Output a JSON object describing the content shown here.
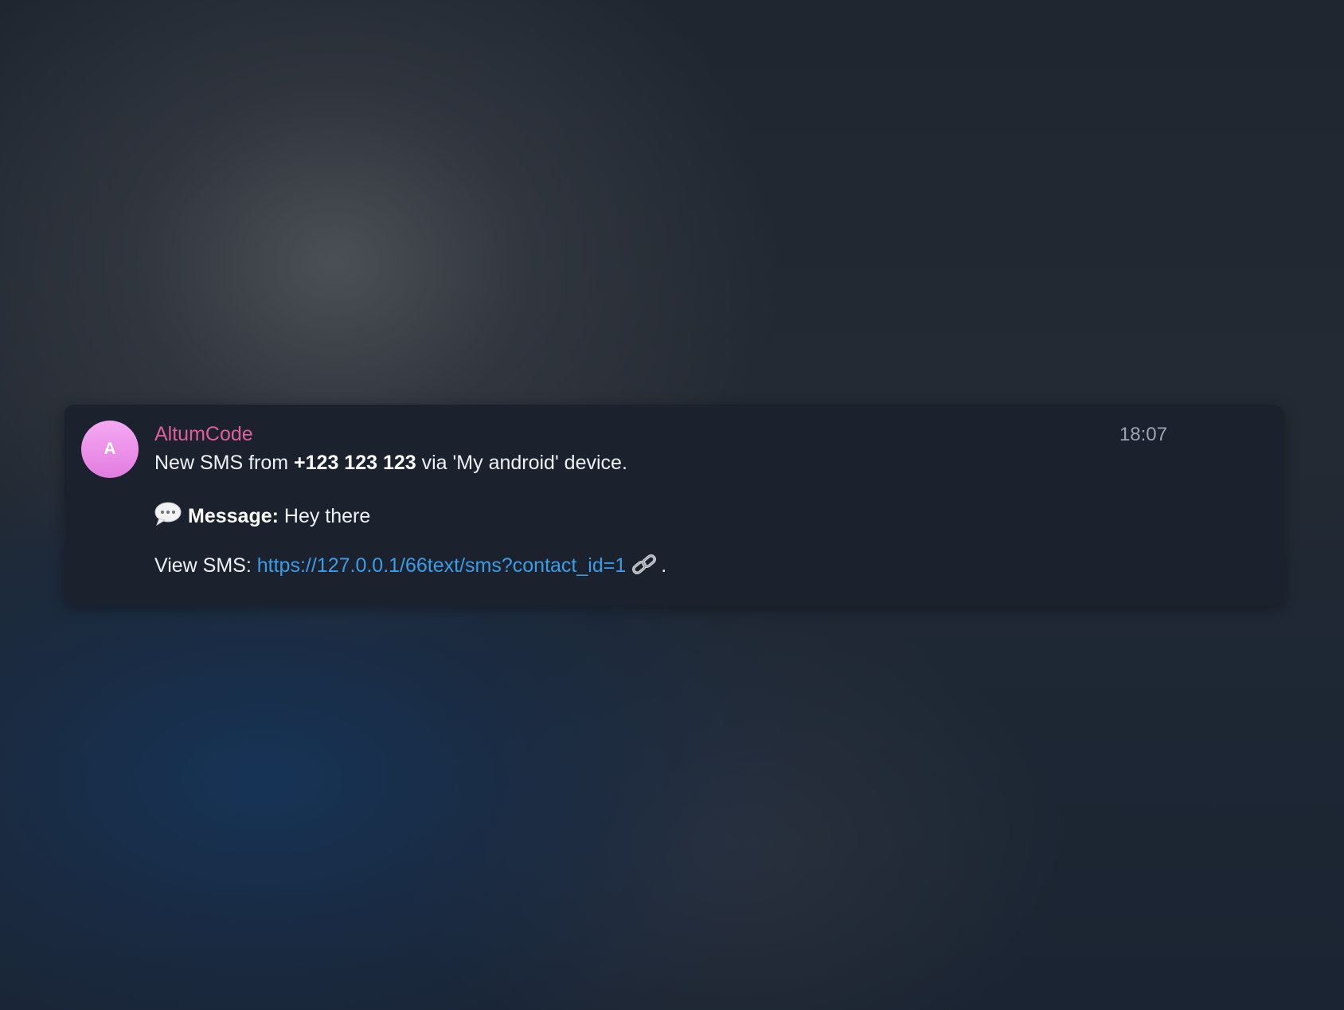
{
  "notification": {
    "avatar_letter": "A",
    "sender": "AltumCode",
    "time": "18:07",
    "line1": {
      "prefix": "New SMS from ",
      "phone": "+123 123 123",
      "suffix": " via 'My android' device."
    },
    "line2": {
      "icon": "speech-bubble-icon",
      "label": "Message:",
      "text": " Hey there"
    },
    "line3": {
      "label": "View SMS: ",
      "url": "https://127.0.0.1/66text/sms?contact_id=1",
      "icon": "link-icon",
      "end": "."
    }
  },
  "colors": {
    "sender": "#df5f9a",
    "link": "#3b9de8",
    "card": "#1b222d",
    "avatar": "#e98ae8"
  }
}
